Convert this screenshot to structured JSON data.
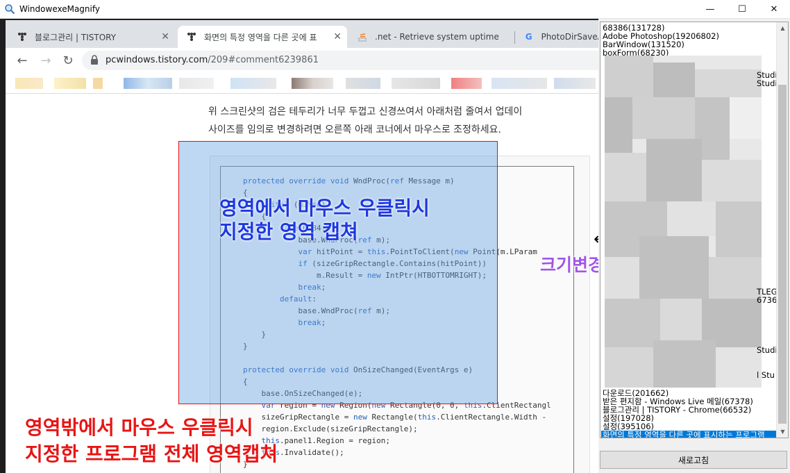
{
  "window": {
    "title": "WindowexeMagnify",
    "minimize_glyph": "—",
    "maximize_glyph": "☐",
    "close_glyph": "✕"
  },
  "browser": {
    "tabs": [
      {
        "label": "블로그관리 | TISTORY",
        "icon": "tistory-icon"
      },
      {
        "label": "화면의 특정 영역을 다른 곳에 표",
        "icon": "tistory-icon",
        "active": true
      },
      {
        "label": ".net - Retrieve system uptime u",
        "icon": "stackoverflow-icon"
      },
      {
        "label": "PhotoDirSaveAs",
        "icon": "google-icon"
      }
    ],
    "tab_close_glyph": "✕",
    "back_glyph": "←",
    "forward_glyph": "→",
    "reload_glyph": "↻",
    "url_host": "pcwindows.tistory.com",
    "url_path": "/209#comment6239861"
  },
  "article": {
    "line1": "위 스크린샷의 검은 테두리가 너무 두껍고 신경쓰여서 아래처럼 줄여서 업데이",
    "line2": "사이즈를 임의로 변경하려면 오른쪽 아래 코너에서 마우스로 조정하세요.",
    "code_lines": [
      "protected override void WndProc(ref Message m)",
      "{",
      "    switch (m.Msg)",
      "    {",
      "        case 0x84:",
      "            base.WndProc(ref m);",
      "            var hitPoint = this.PointToClient(new Point(m.LParam",
      "            if (sizeGripRectangle.Contains(hitPoint))",
      "                m.Result = new IntPtr(HTBOTTOMRIGHT);",
      "            break;",
      "        default:",
      "            base.WndProc(ref m);",
      "            break;",
      "    }",
      "}",
      "",
      "protected override void OnSizeChanged(EventArgs e)",
      "{",
      "    base.OnSizeChanged(e);",
      "    var region = new Region(new Rectangle(0, 0, this.ClientRectangl",
      "    sizeGripRectangle = new Rectangle(this.ClientRectangle.Width -",
      "    region.Exclude(sizeGripRectangle);",
      "    this.panel1.Region = region;",
      "    this.Invalidate();",
      "}"
    ]
  },
  "annotations": {
    "blue_line1": "영역에서 마우스 우클릭시",
    "blue_line2": "지정한 영역 캡쳐",
    "red_line1": "영역밖에서 마우스 우클릭시",
    "red_line2": "지정한 프로그램 전체 영역캡쳐",
    "purple": "크기변경 가능",
    "resize_cursor_glyph": "↔"
  },
  "process_list": {
    "top_items": [
      "68386(131728)",
      "Adobe Photoshop(19206802)",
      "BarWindow(131520)",
      "boxForm(68230)"
    ],
    "bottom_items": [
      "다운로드(201662)",
      "받은 편지함 - Windows Live 메일(67378)",
      "블로그관리 | TISTORY - Chrome(66532)",
      "설정(197028)",
      "설정(395106)"
    ],
    "selected_item": "화면의 특정 영역을 다른 곳에 표시하는 프로그램",
    "partial_right_fragments": [
      "Studi",
      "Studi",
      "TLEG",
      "6736",
      "Studi",
      "l Stu"
    ],
    "refresh_label": "새로고침"
  }
}
